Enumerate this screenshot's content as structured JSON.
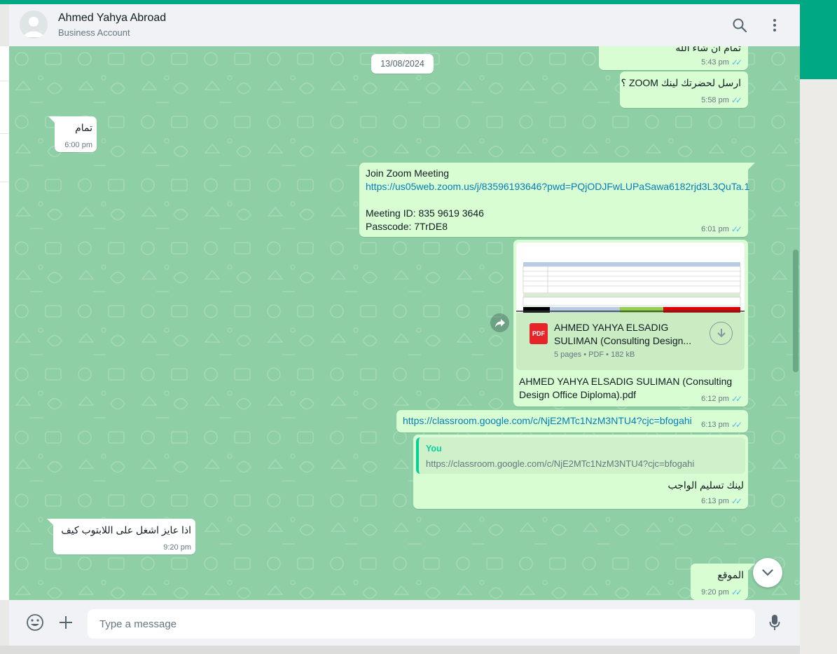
{
  "header": {
    "contact_name": "Ahmed Yahya Abroad",
    "contact_subtitle": "Business Account"
  },
  "date_chip": "13/08/2024",
  "messages": [
    {
      "dir": "out",
      "text": "تمام ان شاء الله",
      "time": "5:43 pm"
    },
    {
      "dir": "out",
      "text": "ارسل لحضرتك لينك ZOOM ؟",
      "time": "5:58 pm"
    },
    {
      "dir": "in",
      "text": "تمام",
      "time": "6:00 pm"
    },
    {
      "dir": "out",
      "line1": "Join Zoom Meeting",
      "link": "https://us05web.zoom.us/j/83596193646?pwd=PQjODJFwLUPaSawa6182rjd3L3QuTa.1",
      "line3": "Meeting ID: 835 9619 3646",
      "line4": "Passcode: 7TrDE8",
      "time": "6:01 pm"
    },
    {
      "dir": "out",
      "doc_title": "AHMED YAHYA ELSADIG SULIMAN (Consulting Design...",
      "doc_info": "5 pages • PDF • 182 kB",
      "pdf_label": "PDF",
      "caption_line1": "AHMED YAHYA ELSADIG SULIMAN (Consulting",
      "caption_line2": "Design Office Diploma).pdf",
      "time": "6:12 pm"
    },
    {
      "dir": "out",
      "link": "https://classroom.google.com/c/NjE2MTc1NzM3NTU4?cjc=bfogahi",
      "time": "6:13 pm"
    },
    {
      "dir": "out",
      "quote_author": "You",
      "quote_text": "https://classroom.google.com/c/NjE2MTc1NzM3NTU4?cjc=bfogahi",
      "text": "لينك تسليم الواجب",
      "time": "6:13 pm"
    },
    {
      "dir": "in",
      "text": "اذا عايز اشغل على اللابتوب كيف",
      "time": "9:20 pm"
    },
    {
      "dir": "out",
      "text": "الموقع",
      "time": "9:20 pm"
    }
  ],
  "footer": {
    "placeholder": "Type a message"
  },
  "colors": {
    "accent": "#00a884",
    "chat_bg": "#8fcfa6",
    "outgoing_bubble": "#d9fdd3",
    "incoming_bubble": "#ffffff",
    "read_ticks": "#53bdeb",
    "link": "#027eb5"
  },
  "icons": [
    "default-avatar-icon",
    "search-icon",
    "menu-dots-icon",
    "forward-icon",
    "pdf-icon",
    "download-icon",
    "chevron-down-icon",
    "emoji-icon",
    "plus-icon",
    "microphone-icon",
    "read-ticks-icon"
  ]
}
